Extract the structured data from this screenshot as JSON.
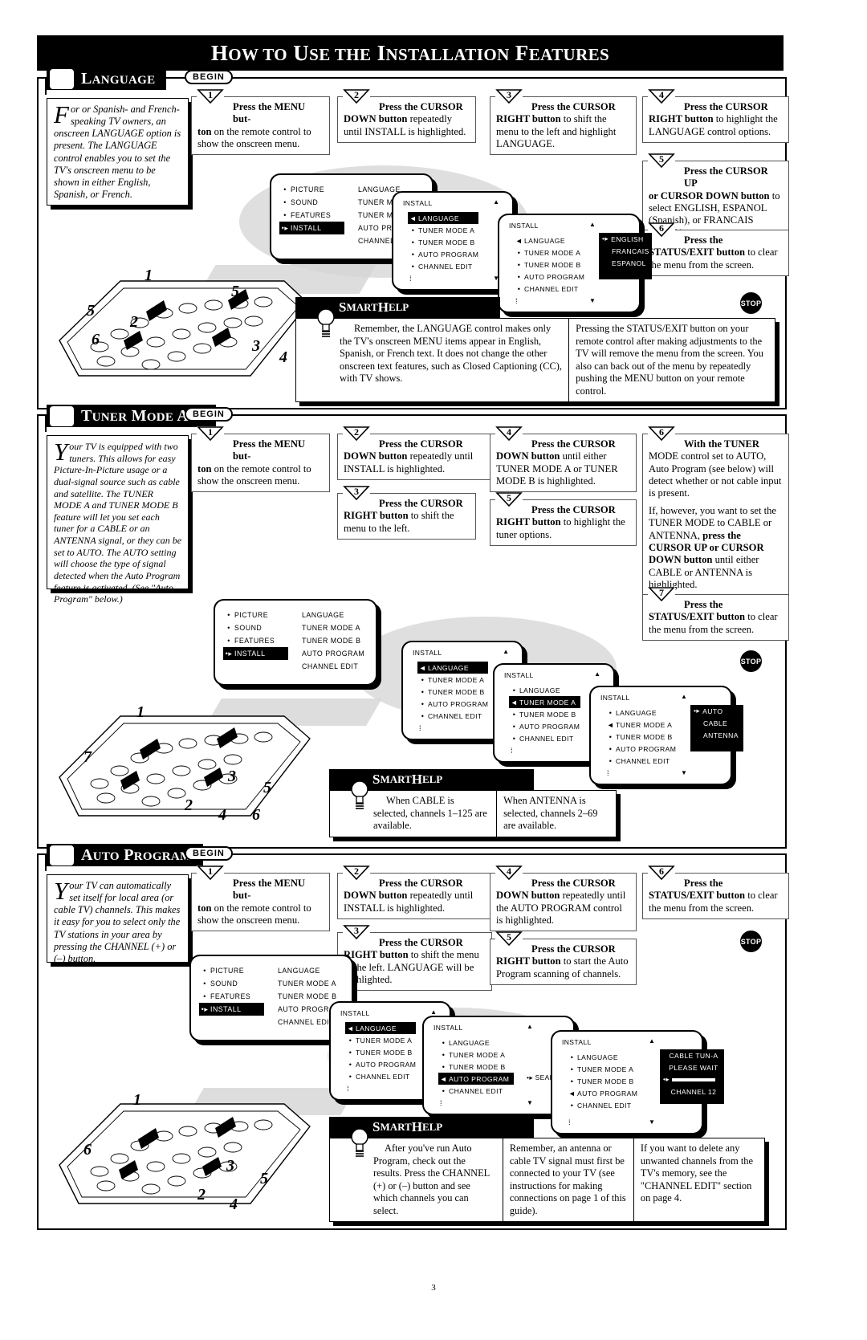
{
  "page": {
    "title": "How to Use the Installation Features",
    "number": "3"
  },
  "sections": [
    {
      "id": "language",
      "label": "Language",
      "begin": "BEGIN",
      "intro": {
        "dropcap": "F",
        "text": "or or Spanish- and French-speaking TV owners, an onscreen LANGUAGE option is present. The LANGUAGE control enables you to set the TV's onscreen menu to be shown in either English, Spanish, or French."
      },
      "steps": [
        {
          "num": "1",
          "bold1": "Press the MENU but-",
          "rest": "ton on the remote control to show the onscreen menu.",
          "boldrest": "ton"
        },
        {
          "num": "2",
          "bold1": "Press the CURSOR",
          "rest": "DOWN button repeatedly until INSTALL is highlighted.",
          "boldrest": "DOWN button"
        },
        {
          "num": "3",
          "bold1": "Press the CURSOR",
          "rest": "RIGHT button to shift the menu to the left and highlight LANGUAGE.",
          "boldrest": "RIGHT button"
        },
        {
          "num": "4",
          "bold1": "Press the CURSOR",
          "rest": "RIGHT button to highlight the LANGUAGE control options.",
          "boldrest": "RIGHT button"
        },
        {
          "num": "5",
          "bold1": "Press the CURSOR UP",
          "rest": "or CURSOR DOWN button to select ENGLISH, ESPANOL (Spanish), or FRANCAIS (French).",
          "boldrest": "or CURSOR DOWN button"
        },
        {
          "num": "6",
          "bold1": "Press the",
          "rest": "STATUS/EXIT button to clear the menu from the screen.",
          "boldrest": "STATUS/EXIT button"
        }
      ],
      "smart_help": {
        "header": "Smart Help",
        "columns": [
          "Remember, the LANGUAGE control makes only the TV's onscreen MENU items appear in English, Spanish, or French text.  It does not change the other onscreen text features, such as Closed Captioning (CC), with TV shows.",
          "Pressing the STATUS/EXIT button on your remote control after making adjustments to the TV will remove the menu from the screen.  You also can back out of the menu by repeatedly pushing the MENU button on your remote control."
        ]
      },
      "stop_label": "STOP",
      "callouts": [
        "1",
        "5",
        "2",
        "6",
        "3",
        "4",
        "5"
      ],
      "osd_main": {
        "left": [
          "PICTURE",
          "SOUND",
          "FEATURES",
          "INSTALL"
        ],
        "left_highlight": "INSTALL",
        "right": [
          "LANGUAGE",
          "TUNER MODE A",
          "TUNER MODE B",
          "AUTO PROGRAM",
          "CHANNEL EDIT"
        ]
      },
      "osd_screens": [
        {
          "title": "INSTALL",
          "items": [
            "LANGUAGE",
            "TUNER MODE A",
            "TUNER MODE B",
            "AUTO PROGRAM",
            "CHANNEL EDIT"
          ],
          "highlight": "LANGUAGE"
        },
        {
          "title": "INSTALL",
          "items": [
            "LANGUAGE",
            "TUNER MODE A",
            "TUNER MODE B",
            "AUTO PROGRAM",
            "CHANNEL EDIT"
          ],
          "highlight": "LANGUAGE",
          "options": [
            "ENGLISH",
            "FRANCAIS",
            "ESPANOL"
          ],
          "option_selected": "ENGLISH"
        }
      ]
    },
    {
      "id": "tuner-mode",
      "label": "Tuner Mode A/B",
      "begin": "BEGIN",
      "intro": {
        "dropcap": "Y",
        "text": "our TV is equipped with two tuners. This allows for easy Picture-In-Picture usage or a dual-signal source such as cable and satellite. The TUNER MODE A and TUNER MODE B feature will let you set each tuner for a CABLE or an ANTENNA signal, or they can be set to AUTO. The AUTO setting will choose the type of signal detected when the Auto Program feature is activated. (See \"Auto Program\" below.)"
      },
      "steps": [
        {
          "num": "1",
          "bold1": "Press the MENU but-",
          "rest": "ton on the remote control to show the onscreen menu.",
          "boldrest": "ton"
        },
        {
          "num": "2",
          "bold1": "Press the CURSOR",
          "rest": "DOWN button repeatedly until INSTALL is highlighted.",
          "boldrest": "DOWN button"
        },
        {
          "num": "3",
          "bold1": "Press the CURSOR",
          "rest": "RIGHT button to shift the menu to the left.",
          "boldrest": "RIGHT button"
        },
        {
          "num": "4",
          "bold1": "Press the CURSOR",
          "rest": "DOWN button until either TUNER MODE A or TUNER MODE B is highlighted.",
          "boldrest": "DOWN button"
        },
        {
          "num": "5",
          "bold1": "Press the CURSOR",
          "rest": "RIGHT button to highlight the tuner options.",
          "boldrest": "RIGHT button"
        },
        {
          "num": "6",
          "bold1": "With the TUNER",
          "rest": "MODE control set to AUTO, Auto Program (see below) will detect whether or not cable input is present.",
          "rest2": "If, however, you want to set the TUNER MODE to CABLE or ANTENNA, press the CURSOR UP or CURSOR DOWN button until either CABLE or ANTENNA is highlighted.",
          "boldrest": "press the CURSOR UP or CURSOR DOWN button"
        },
        {
          "num": "7",
          "bold1": "Press the",
          "rest": "STATUS/EXIT button to clear the menu from the screen.",
          "boldrest": "STATUS/EXIT button"
        }
      ],
      "smart_help": {
        "header": "Smart Help",
        "columns": [
          "When CABLE is selected, channels 1–125 are available.",
          "When ANTENNA is selected, channels 2–69 are available."
        ]
      },
      "stop_label": "STOP",
      "callouts": [
        "1",
        "7",
        "3",
        "5",
        "2",
        "4",
        "6"
      ],
      "osd_main": {
        "left": [
          "PICTURE",
          "SOUND",
          "FEATURES",
          "INSTALL"
        ],
        "left_highlight": "INSTALL",
        "right": [
          "LANGUAGE",
          "TUNER MODE A",
          "TUNER MODE B",
          "AUTO PROGRAM",
          "CHANNEL EDIT"
        ]
      },
      "osd_screens": [
        {
          "title": "INSTALL",
          "items": [
            "LANGUAGE",
            "TUNER MODE A",
            "TUNER MODE B",
            "AUTO PROGRAM",
            "CHANNEL EDIT"
          ],
          "highlight": "LANGUAGE"
        },
        {
          "title": "INSTALL",
          "items": [
            "LANGUAGE",
            "TUNER MODE A",
            "TUNER MODE B",
            "AUTO PROGRAM",
            "CHANNEL EDIT"
          ],
          "highlight": "TUNER MODE A"
        },
        {
          "title": "INSTALL",
          "items": [
            "LANGUAGE",
            "TUNER MODE A",
            "TUNER MODE B",
            "AUTO PROGRAM",
            "CHANNEL EDIT"
          ],
          "highlight": "TUNER MODE A",
          "options": [
            "AUTO",
            "CABLE",
            "ANTENNA"
          ],
          "option_selected": "AUTO"
        }
      ]
    },
    {
      "id": "auto-program",
      "label": "Auto Program",
      "begin": "BEGIN",
      "intro": {
        "dropcap": "Y",
        "text": "our TV can automatically set itself for local area (or cable TV) channels.  This makes it easy for you to select only the TV stations in your area by pressing the CHANNEL (+) or (–) button."
      },
      "steps": [
        {
          "num": "1",
          "bold1": "Press the MENU but-",
          "rest": "ton on the remote control to show the onscreen menu.",
          "boldrest": "ton"
        },
        {
          "num": "2",
          "bold1": "Press the CURSOR",
          "rest": "DOWN button repeatedly until INSTALL is highlighted.",
          "boldrest": "DOWN button"
        },
        {
          "num": "3",
          "bold1": "Press the CURSOR",
          "rest": "RIGHT button to shift the menu to the left. LANGUAGE will be highlighted.",
          "boldrest": "RIGHT button"
        },
        {
          "num": "4",
          "bold1": "Press the CURSOR",
          "rest": "DOWN button repeatedly until the AUTO PROGRAM control is highlighted.",
          "boldrest": "DOWN button"
        },
        {
          "num": "5",
          "bold1": "Press the CURSOR",
          "rest": "RIGHT button to start the Auto Program scanning of channels.",
          "boldrest": "RIGHT button"
        },
        {
          "num": "6",
          "bold1": "Press the",
          "rest": "STATUS/EXIT button to clear the menu from the screen.",
          "boldrest": "STATUS/EXIT button"
        }
      ],
      "smart_help": {
        "header": "Smart Help",
        "columns": [
          "After you've run Auto Program, check out the results.  Press the CHANNEL (+) or (–) button and see which channels you can select.",
          "Remember, an antenna or cable TV signal must first be connected to your TV (see instructions for making connections on page 1 of this guide).",
          "If you want to delete any unwanted channels from the TV's memory, see the \"CHANNEL EDIT\" section on page 4."
        ]
      },
      "stop_label": "STOP",
      "callouts": [
        "1",
        "6",
        "3",
        "5",
        "2",
        "4"
      ],
      "osd_main": {
        "left": [
          "PICTURE",
          "SOUND",
          "FEATURES",
          "INSTALL"
        ],
        "left_highlight": "INSTALL",
        "right": [
          "LANGUAGE",
          "TUNER MODE A",
          "TUNER MODE B",
          "AUTO PROGRAM",
          "CHANNEL EDIT"
        ]
      },
      "osd_screens": [
        {
          "title": "INSTALL",
          "items": [
            "LANGUAGE",
            "TUNER MODE A",
            "TUNER MODE B",
            "AUTO PROGRAM",
            "CHANNEL EDIT"
          ],
          "highlight": "LANGUAGE"
        },
        {
          "title": "INSTALL",
          "items": [
            "LANGUAGE",
            "TUNER MODE A",
            "TUNER MODE B",
            "AUTO PROGRAM",
            "CHANNEL EDIT"
          ],
          "highlight": "AUTO PROGRAM",
          "side_label": "SEARCH"
        },
        {
          "title": "INSTALL",
          "items": [
            "LANGUAGE",
            "TUNER MODE A",
            "TUNER MODE B",
            "AUTO PROGRAM",
            "CHANNEL EDIT"
          ],
          "highlight": "AUTO PROGRAM",
          "status": {
            "line1": "CABLE    TUN-A",
            "line2": "PLEASE WAIT",
            "line3": "CHANNEL   12"
          }
        }
      ]
    }
  ],
  "colors": {
    "ink": "#000000",
    "paper": "#ffffff",
    "shadow_gray": "#d9d9d9"
  }
}
